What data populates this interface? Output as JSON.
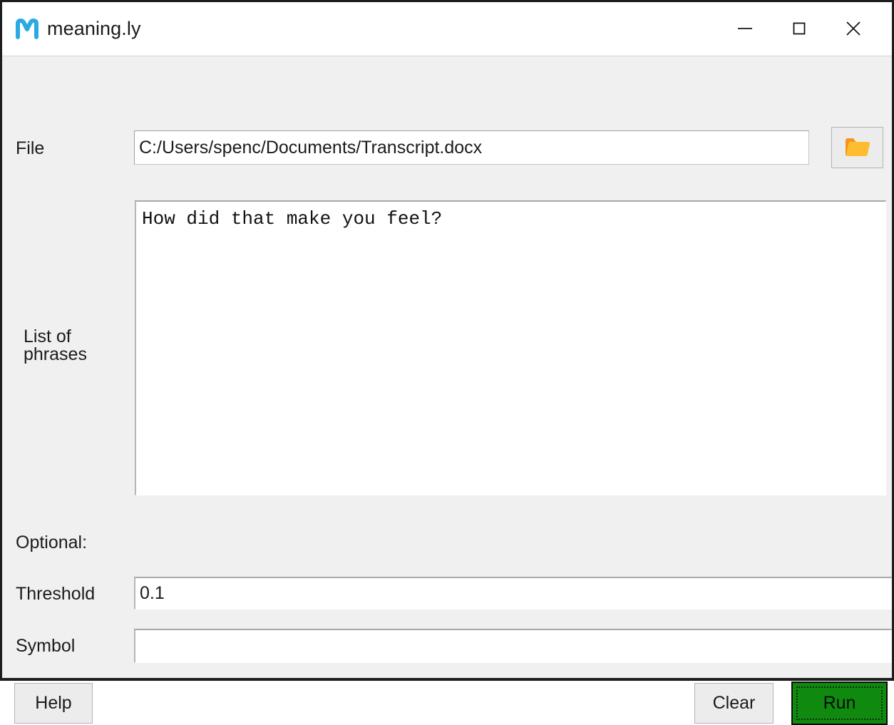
{
  "window": {
    "title": "meaning.ly",
    "logo_icon": "m-logo-icon",
    "logo_color": "#29abe2",
    "controls": {
      "minimize_icon": "minimize-icon",
      "maximize_icon": "maximize-icon",
      "close_icon": "close-icon"
    }
  },
  "form": {
    "file": {
      "label": "File",
      "value": "C:/Users/spenc/Documents/Transcript.docx",
      "placeholder": "",
      "browse_icon": "folder-open-icon",
      "browse_icon_color": "#f5a623"
    },
    "phrases": {
      "label": "List of\nphrases",
      "value": "How did that make you feel?",
      "placeholder": ""
    },
    "optional": {
      "label": "Optional:",
      "threshold": {
        "label": "Threshold",
        "value": "0.1",
        "placeholder": ""
      },
      "symbol": {
        "label": "Symbol",
        "value": "",
        "placeholder": ""
      }
    }
  },
  "actions": {
    "help_label": "Help",
    "clear_label": "Clear",
    "run_label": "Run",
    "run_color": "#0f8a0f"
  }
}
